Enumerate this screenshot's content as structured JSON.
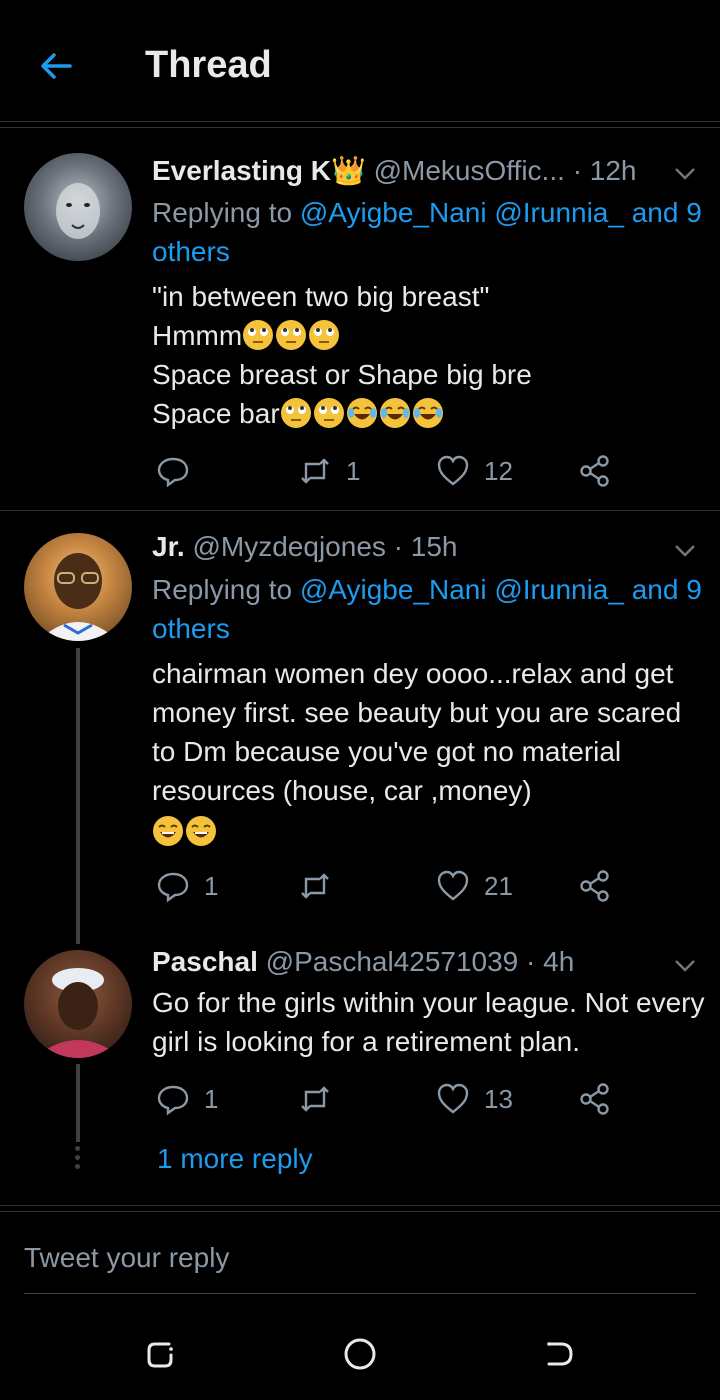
{
  "header": {
    "title": "Thread"
  },
  "tweets": [
    {
      "name": "Everlasting K👑",
      "handle": "@MekusOffic...",
      "time": "· 12h",
      "replying_prefix": "Replying to",
      "replying_links": "@Ayigbe_Nani @Irunnia_ and 9 others",
      "lines": [
        "\"in between two big breast\"",
        "Hmmm",
        "Space breast or Shape big bre",
        "Space bar"
      ],
      "replies": "",
      "retweets": "1",
      "likes": "12"
    },
    {
      "name": "Jr.",
      "handle": "@Myzdeqjones",
      "time": "· 15h",
      "replying_prefix": "Replying to",
      "replying_links": "@Ayigbe_Nani @Irunnia_ and 9 others",
      "text": "chairman women dey oooo...relax and get money first. see beauty but you are scared to Dm because you've got no material resources (house, car ,money)",
      "replies": "1",
      "retweets": "",
      "likes": "21"
    },
    {
      "name": "Paschal",
      "handle": "@Paschal42571039",
      "time": "· 4h",
      "text": "Go for the girls within your league. Not every girl is looking for a retirement plan.",
      "replies": "1",
      "retweets": "",
      "likes": "13"
    }
  ],
  "more_reply": "1 more reply",
  "composer": {
    "placeholder": "Tweet your reply"
  },
  "colors": {
    "accent": "#1d9bf0",
    "muted": "#8b98a5",
    "background": "#000000"
  }
}
